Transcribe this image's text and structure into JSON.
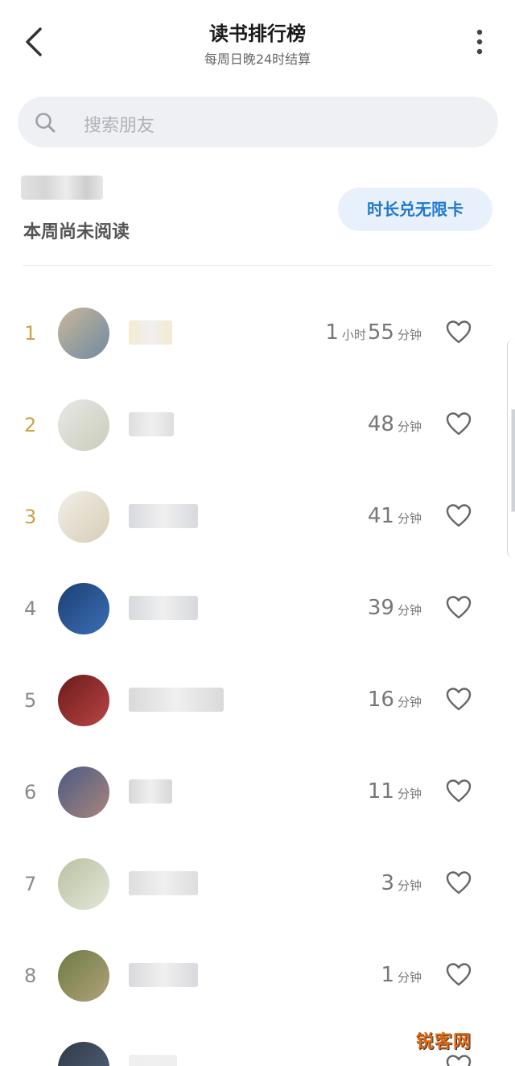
{
  "header": {
    "title": "读书排行榜",
    "subtitle": "每周日晚24时结算"
  },
  "search": {
    "placeholder": "搜索朋友"
  },
  "me": {
    "status": "本周尚未阅读",
    "card_button": "时长兑无限卡"
  },
  "ranking": [
    {
      "rank": "1",
      "parts": [
        {
          "num": "1",
          "unit": "小时"
        },
        {
          "num": "55",
          "unit": "分钟"
        }
      ],
      "avatar_colors": [
        "#c9b79a",
        "#6f8aa1"
      ],
      "name_color": "#efe2bd"
    },
    {
      "rank": "2",
      "parts": [
        {
          "num": "48",
          "unit": "分钟"
        }
      ],
      "avatar_colors": [
        "#e8e8e8",
        "#c9cdb8"
      ],
      "name_color": "#cfcfcf"
    },
    {
      "rank": "3",
      "parts": [
        {
          "num": "41",
          "unit": "分钟"
        }
      ],
      "avatar_colors": [
        "#f1efe8",
        "#d8cdb5"
      ],
      "name_color": "#c7c9cf"
    },
    {
      "rank": "4",
      "parts": [
        {
          "num": "39",
          "unit": "分钟"
        }
      ],
      "avatar_colors": [
        "#1c3f73",
        "#3b6fb5"
      ],
      "name_color": "#c4c8ce"
    },
    {
      "rank": "5",
      "parts": [
        {
          "num": "16",
          "unit": "分钟"
        }
      ],
      "avatar_colors": [
        "#6b1a1a",
        "#b94545"
      ],
      "name_color": "#c9c9c9"
    },
    {
      "rank": "6",
      "parts": [
        {
          "num": "11",
          "unit": "分钟"
        }
      ],
      "avatar_colors": [
        "#4a5a86",
        "#a9857a"
      ],
      "name_color": "#c6c6c6"
    },
    {
      "rank": "7",
      "parts": [
        {
          "num": "3",
          "unit": "分钟"
        }
      ],
      "avatar_colors": [
        "#b9c2a0",
        "#e3e6da"
      ],
      "name_color": "#cfcfcf"
    },
    {
      "rank": "8",
      "parts": [
        {
          "num": "1",
          "unit": "分钟"
        }
      ],
      "avatar_colors": [
        "#6e7a45",
        "#b0a27a"
      ],
      "name_color": "#c9c9cf"
    },
    {
      "rank": "",
      "parts": [],
      "avatar_colors": [
        "#2f3a4a",
        "#56627a"
      ],
      "name_color": "#e8e8e8"
    }
  ],
  "colors": {
    "accent_blue": "#1e78d2",
    "top_rank_gold": "#c9a24a",
    "rank_gray": "#8a8a8a"
  },
  "icons": {
    "back": "chevron-left-icon",
    "more": "vertical-dots-icon",
    "search": "search-icon",
    "like": "heart-outline-icon"
  },
  "watermark": "锐客网"
}
